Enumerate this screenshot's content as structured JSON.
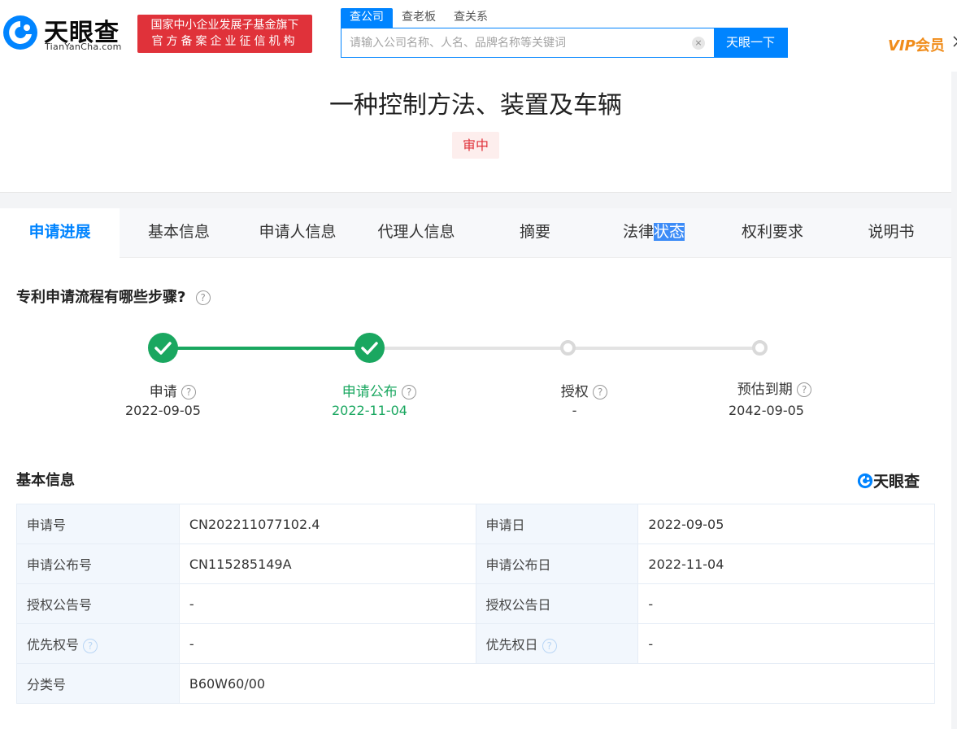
{
  "header": {
    "logo_cn": "天眼查",
    "logo_en": "TianYanCha.com",
    "badge_line1": "国家中小企业发展子基金旗下",
    "badge_line2": "官方备案企业征信机构",
    "search_tabs": [
      "查公司",
      "查老板",
      "查关系"
    ],
    "search_placeholder": "请输入公司名称、人名、品牌名称等关键词",
    "search_button": "天眼一下",
    "vip_prefix": "VIP",
    "vip_label": "会员",
    "brand_color": "#0084ff"
  },
  "patent": {
    "title": "一种控制方法、装置及车辆",
    "status": "审中"
  },
  "tabs": {
    "items": [
      "申请进展",
      "基本信息",
      "申请人信息",
      "代理人信息",
      "摘要",
      "法律",
      "权利要求",
      "说明书"
    ],
    "selected_part": "状态",
    "active_index": 0
  },
  "progress": {
    "heading": "专利申请流程有哪些步骤?",
    "steps": [
      {
        "label": "申请",
        "date": "2022-09-05",
        "done": true
      },
      {
        "label": "申请公布",
        "date": "2022-11-04",
        "done": true
      },
      {
        "label": "授权",
        "date": "-",
        "done": false
      },
      {
        "label": "预估到期",
        "date": "2042-09-05",
        "done": false
      }
    ],
    "done_color": "#1aa760"
  },
  "basic_info": {
    "heading": "基本信息",
    "watermark": "天眼查",
    "rows": [
      {
        "k1": "申请号",
        "v1": "CN202211077102.4",
        "k2": "申请日",
        "v2": "2022-09-05"
      },
      {
        "k1": "申请公布号",
        "v1": "CN115285149A",
        "k2": "申请公布日",
        "v2": "2022-11-04"
      },
      {
        "k1": "授权公告号",
        "v1": "-",
        "k2": "授权公告日",
        "v2": "-"
      },
      {
        "k1": "优先权号",
        "v1": "-",
        "k2": "优先权日",
        "v2": "-"
      },
      {
        "k1": "分类号",
        "v1": "B60W60/00"
      }
    ]
  },
  "icons": {
    "help": "?",
    "clear": "×"
  }
}
